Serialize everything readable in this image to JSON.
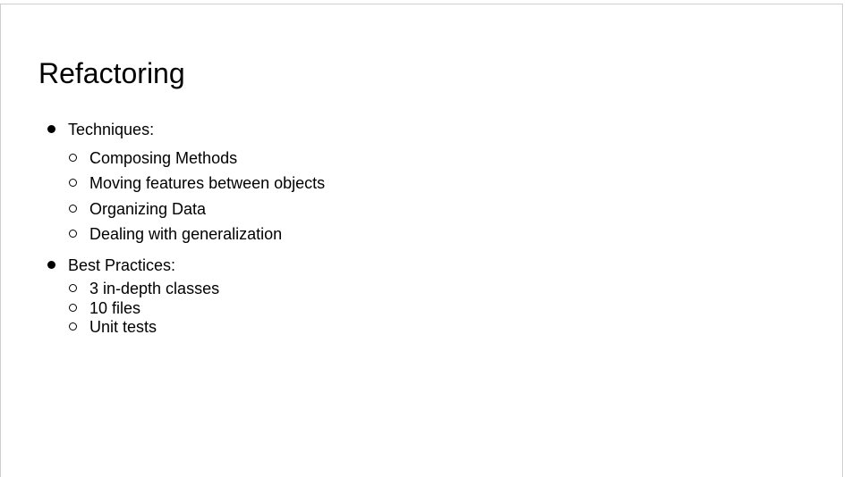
{
  "slide": {
    "title": "Refactoring",
    "sections": [
      {
        "label": "Techniques:",
        "items": [
          "Composing Methods",
          "Moving features between objects",
          "Organizing Data",
          "Dealing with generalization"
        ]
      },
      {
        "label": "Best Practices:",
        "items": [
          "3 in-depth classes",
          "10 files",
          "Unit tests"
        ]
      }
    ]
  }
}
